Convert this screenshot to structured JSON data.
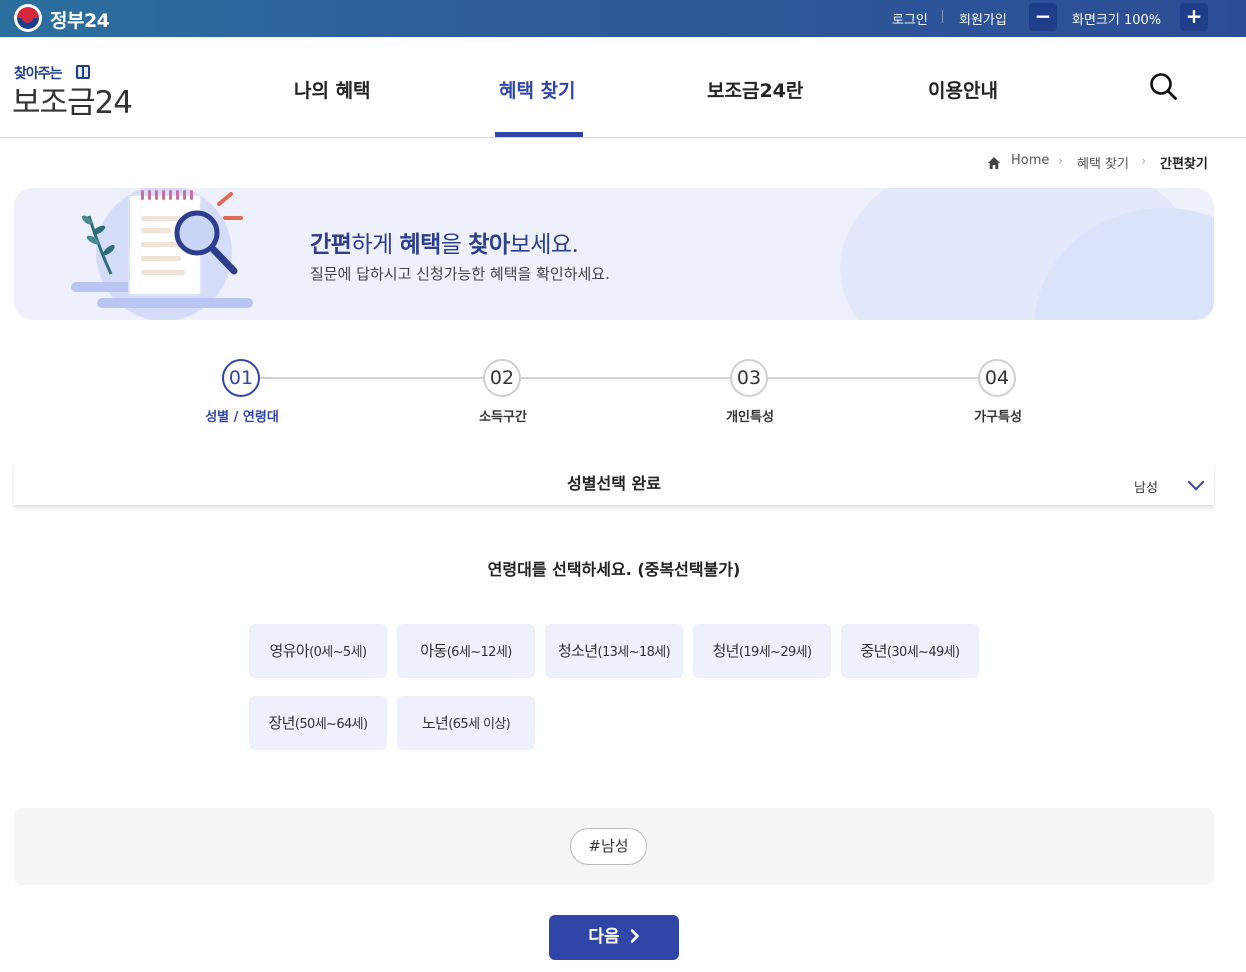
{
  "topbar": {
    "gov_name": "정부24",
    "login": "로그인",
    "signup": "회원가입",
    "zoom_minus": "−",
    "zoom_label": "화면크기 100%",
    "zoom_plus": "+"
  },
  "header": {
    "logo_top": "찾아주는",
    "logo_main": "보조금24",
    "nav": [
      "나의 혜택",
      "혜택 찾기",
      "보조금24란",
      "이용안내"
    ],
    "active_nav": "혜택 찾기"
  },
  "breadcrumb": [
    "Home",
    "혜택 찾기",
    "간편찾기"
  ],
  "banner": {
    "title_parts": [
      "간편",
      "하게 ",
      "혜택",
      "을 ",
      "찾아",
      "보세요."
    ],
    "subtitle": "질문에 답하시고 신청가능한 혜택을 확인하세요."
  },
  "steps": [
    {
      "num": "01",
      "label": "성별 / 연령대",
      "active": true
    },
    {
      "num": "02",
      "label": "소득구간",
      "active": false
    },
    {
      "num": "03",
      "label": "개인특성",
      "active": false
    },
    {
      "num": "04",
      "label": "가구특성",
      "active": false
    }
  ],
  "gender_section": {
    "title": "성별선택 완료",
    "value": "남성"
  },
  "age_question": "연령대를 선택하세요. (중복선택불가)",
  "age_options": [
    {
      "name": "영유아",
      "range": "(0세~5세)"
    },
    {
      "name": "아동",
      "range": "(6세~12세)"
    },
    {
      "name": "청소년",
      "range": "(13세~18세)"
    },
    {
      "name": "청년",
      "range": "(19세~29세)"
    },
    {
      "name": "중년",
      "range": "(30세~49세)"
    },
    {
      "name": "장년",
      "range": "(50세~64세)"
    },
    {
      "name": "노년",
      "range": "(65세 이상)"
    }
  ],
  "selected_tags": [
    "#남성"
  ],
  "next_button": "다음",
  "colors": {
    "accent": "#2f46a8",
    "option_bg": "#eef1fc",
    "banner_bg": "#eef1fc"
  }
}
